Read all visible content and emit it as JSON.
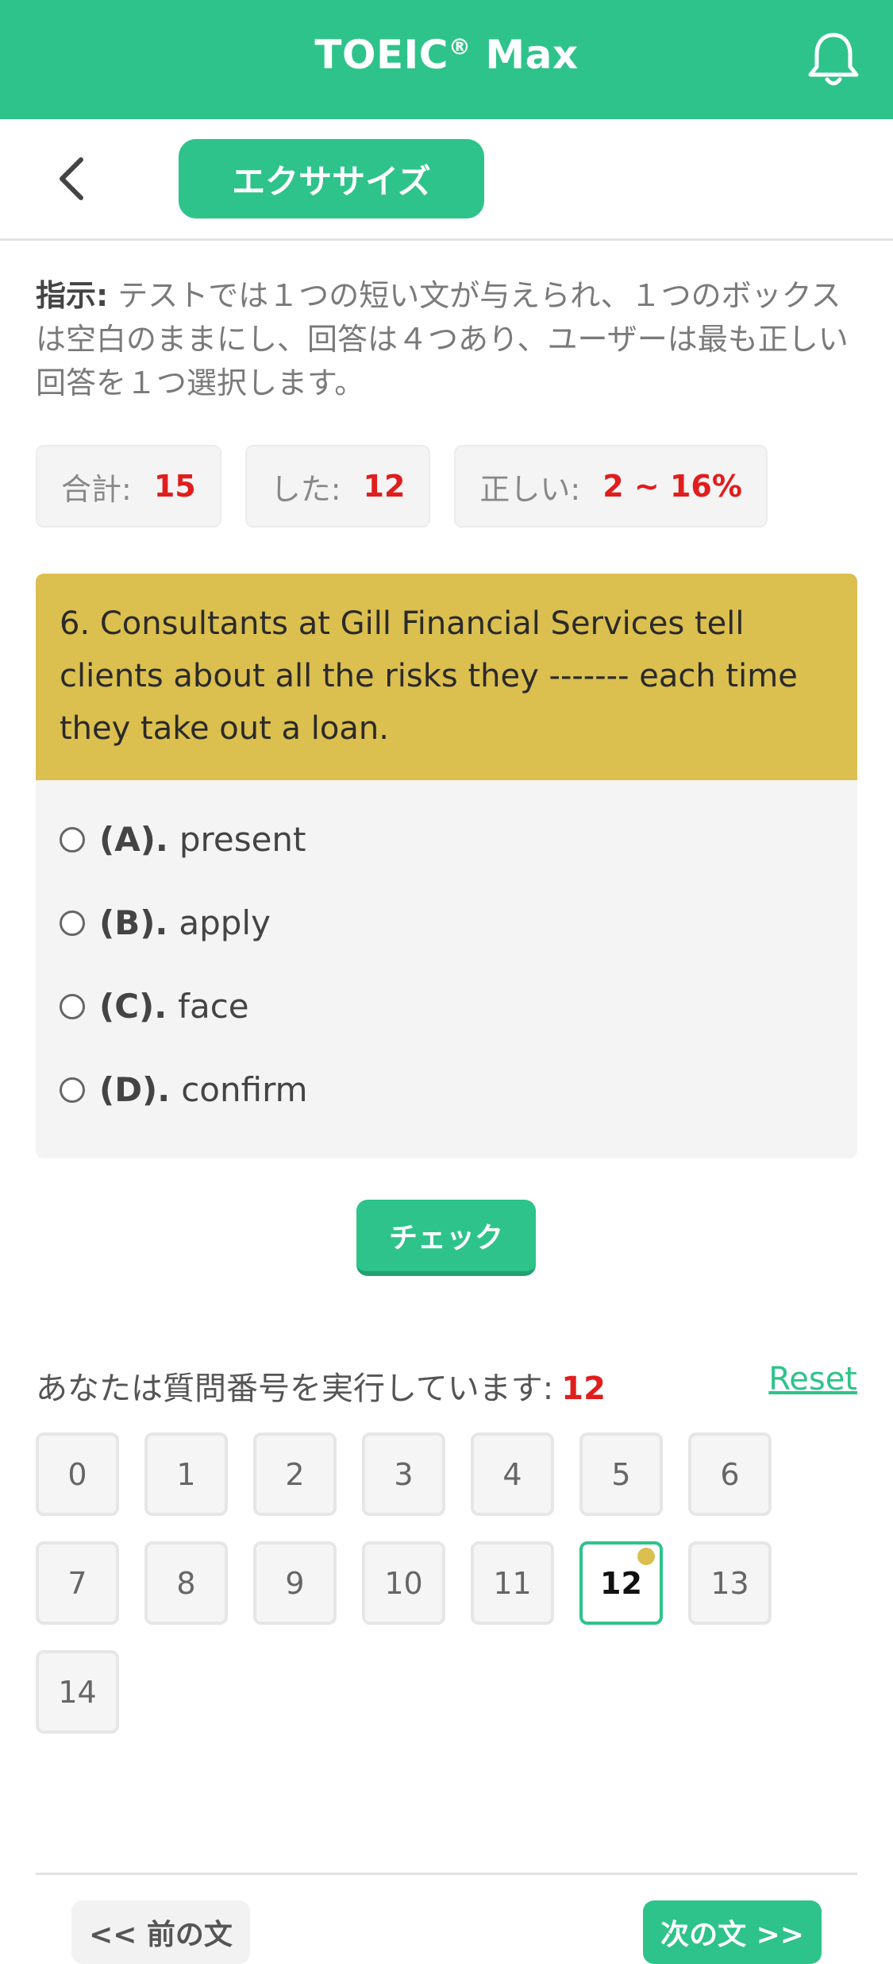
{
  "header": {
    "title": "TOEIC",
    "registered_mark": "®",
    "title_suffix": "Max",
    "notification_icon": "bell-icon"
  },
  "subbar": {
    "back_icon": "chevron-left-icon",
    "tab_label": "エクササイズ"
  },
  "instruction": {
    "label": "指示:",
    "text": " テストでは１つの短い文が与えられ、１つのボックスは空白のままにし、回答は４つあり、ユーザーは最も正しい回答を１つ選択します。"
  },
  "stats": {
    "total_label": "合計:",
    "total_value": "15",
    "done_label": "した:",
    "done_value": "12",
    "correct_label": "正しい:",
    "correct_value": "2 ~ 16%"
  },
  "question": {
    "text": "6. Consultants at Gill Financial Services tell clients about all the risks they ------- each time they take out a loan.",
    "options": [
      {
        "letter": "(A).",
        "text": "present"
      },
      {
        "letter": "(B).",
        "text": "apply"
      },
      {
        "letter": "(C).",
        "text": "face"
      },
      {
        "letter": "(D).",
        "text": "confirm"
      }
    ]
  },
  "check_label": "チェック",
  "progress": {
    "label": "あなたは質問番号を実行しています:",
    "current": "12",
    "reset_label": "Reset",
    "numbers": [
      "0",
      "1",
      "2",
      "3",
      "4",
      "5",
      "6",
      "7",
      "8",
      "9",
      "10",
      "11",
      "12",
      "13",
      "14"
    ]
  },
  "nav": {
    "prev_label": "<< 前の文",
    "next_label": "次の文 >>"
  },
  "colors": {
    "accent": "#2ec38a",
    "question_bg": "#dbbf4f",
    "highlight_value": "#e11d1d"
  }
}
